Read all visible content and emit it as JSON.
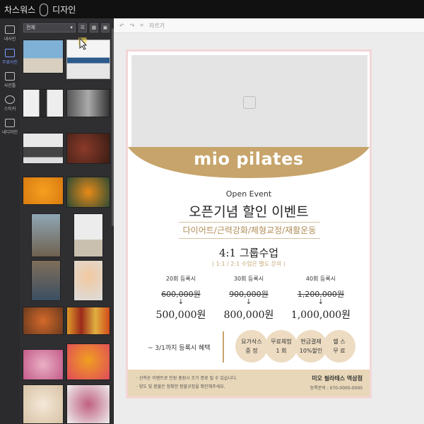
{
  "app": {
    "title_left": "차스워스",
    "title_right": "디자인"
  },
  "sidebar": {
    "items": [
      {
        "label": "내사진",
        "icon": "photo-icon"
      },
      {
        "label": "무료사진",
        "icon": "free-photo-icon",
        "active": true
      },
      {
        "label": "사진틀",
        "icon": "frame-icon"
      },
      {
        "label": "스티커",
        "icon": "sticker-icon"
      },
      {
        "label": "내디자인",
        "icon": "edit-icon"
      }
    ]
  },
  "panel": {
    "filter_value": "전체"
  },
  "toolbar": {
    "crop_label": "자르기"
  },
  "poster": {
    "brand": "mio pilates",
    "open_event": "Open Event",
    "headline": "오픈기념 할인 이벤트",
    "categories": "다이어트/근력강화/체형교정/재활운동",
    "group": "4:1 그룹수업",
    "group_note": "( 1:1 / 2:1 수업은 별도 문의 )",
    "prices": [
      {
        "label": "20회 등록시",
        "old": "600,000원",
        "new": "500,000원"
      },
      {
        "label": "30회 등록시",
        "old": "900,000원",
        "new": "800,000원"
      },
      {
        "label": "40회 등록시",
        "old": "1,200,000원",
        "new": "1,000,000원"
      }
    ],
    "deadline": "~ 3/1까지 등록시 혜택",
    "benefits": [
      {
        "l1": "요가삭스",
        "l2": "증 정"
      },
      {
        "l1": "무료체험",
        "l2": "1 회"
      },
      {
        "l1": "현금결제",
        "l2": "10%할인"
      },
      {
        "l1": "헬 스",
        "l2": "무 료"
      }
    ],
    "footer_note1": "· 선착순 이벤트로 인원 충원시 조기 종료 될 수 있습니다.",
    "footer_note2": "· 양도 및 환불은 정확한 환불규정을 확인해주세요.",
    "footer_brand": "미오 필라테스 역삼점",
    "footer_phone": "등록문의 : 070-0000-0000"
  },
  "colors": {
    "accent": "#c7a46b",
    "footer": "#e8d7b8",
    "circle": "#eddcc2"
  }
}
